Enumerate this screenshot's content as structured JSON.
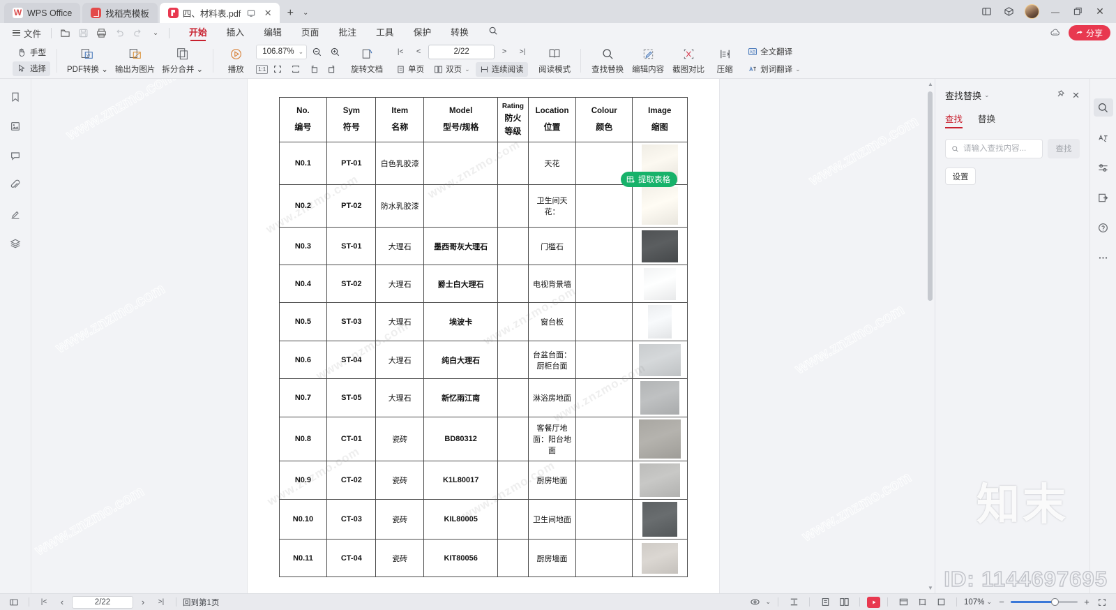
{
  "window": {
    "tabs": [
      {
        "label": "WPS Office",
        "icon": "wps-logo-icon",
        "active": false
      },
      {
        "label": "找稻壳模板",
        "icon": "template-icon",
        "active": false
      },
      {
        "label": "四、材料表.pdf",
        "icon": "pdf-icon",
        "active": true
      }
    ],
    "new_tab": "+",
    "tab_dropdown": "⌄",
    "controls": {
      "split_view": "⊞",
      "cube": "◇",
      "minimize": "—",
      "restore": "❐",
      "close": "✕"
    }
  },
  "menubar": {
    "file": "文件",
    "quick": [
      "new-icon",
      "save-icon",
      "print-icon",
      "undo-icon",
      "redo-icon",
      "customize-icon"
    ],
    "tabs": [
      {
        "label": "开始",
        "active": true
      },
      {
        "label": "插入",
        "active": false
      },
      {
        "label": "编辑",
        "active": false
      },
      {
        "label": "页面",
        "active": false
      },
      {
        "label": "批注",
        "active": false
      },
      {
        "label": "工具",
        "active": false
      },
      {
        "label": "保护",
        "active": false
      },
      {
        "label": "转换",
        "active": false
      }
    ],
    "search_icon": "search-icon",
    "share": "分享"
  },
  "ribbon": {
    "hand": "手型",
    "select": "选择",
    "pdf_convert": "PDF转换",
    "export_image": "输出为图片",
    "split_merge": "拆分合并",
    "play": "播放",
    "zoom_value": "106.87%",
    "zoom_out": "−",
    "zoom_in": "+",
    "fit_actual": "1:1",
    "fit_page": "fit-page-icon",
    "fit_width": "fit-width-icon",
    "rotate_left": "rotate-left-icon",
    "rotate_right": "rotate-right-icon",
    "rotate_doc": "旋转文档",
    "first_page": "|<",
    "prev_page": "<",
    "page_indicator": "2/22",
    "next_page": ">",
    "last_page": ">|",
    "single_page": "单页",
    "double_page": "双页",
    "continuous": "连续阅读",
    "read_mode": "阅读模式",
    "find_replace": "查找替换",
    "edit_content": "编辑内容",
    "screenshot_compare": "截图对比",
    "compress": "压缩",
    "translate_full": "全文翻译",
    "translate_word": "划词翻译"
  },
  "leftrail": {
    "items": [
      {
        "name": "bookmark-icon",
        "label": "书签"
      },
      {
        "name": "thumbnail-icon",
        "label": "缩略图"
      },
      {
        "name": "comment-icon",
        "label": "批注"
      },
      {
        "name": "attachment-icon",
        "label": "附件"
      },
      {
        "name": "signature-icon",
        "label": "签名"
      },
      {
        "name": "layers-icon",
        "label": "图层"
      }
    ]
  },
  "extract_button": {
    "label": "提取表格",
    "color": "#17b26a"
  },
  "find_panel": {
    "title": "查找替换",
    "tabs": [
      {
        "label": "查找",
        "active": true
      },
      {
        "label": "替换",
        "active": false
      }
    ],
    "input_placeholder": "请输入查找内容...",
    "input_value": "",
    "find_button": "查找",
    "settings_button": "设置",
    "pin_icon": "pin-icon",
    "close_icon": "close-icon"
  },
  "rightrail": {
    "items": [
      {
        "name": "search-icon",
        "selected": true
      },
      {
        "name": "translate-icon",
        "selected": false
      },
      {
        "name": "settings-sliders-icon",
        "selected": false
      },
      {
        "name": "export-panel-icon",
        "selected": false
      },
      {
        "name": "help-icon",
        "selected": false
      },
      {
        "name": "more-options-icon",
        "selected": false
      }
    ]
  },
  "statusbar": {
    "sidebar_toggle": "panel-toggle-icon",
    "first": "|<",
    "prev": "‹",
    "page": "2/22",
    "next": "›",
    "last": ">|",
    "back_to_first": "回到第1页",
    "view_icons": [
      "eye-icon",
      "fit-height-icon",
      "single-page-icon",
      "double-page-icon",
      "record-icon",
      "reading-icon",
      "crop-icon",
      "note-icon"
    ],
    "zoom_label": "107%",
    "zoom_minus": "−",
    "zoom_plus": "+",
    "fullscreen": "fullscreen-icon"
  },
  "watermarks": {
    "small": "www.znzmo.com",
    "brand": "知末",
    "id": "ID: 1144697695"
  },
  "document": {
    "table": {
      "headers": [
        {
          "en": "No.",
          "cn": "编号"
        },
        {
          "en": "Sym",
          "cn": "符号"
        },
        {
          "en": "Item",
          "cn": "名称"
        },
        {
          "en": "Model",
          "cn": "型号/规格"
        },
        {
          "en": "Rating",
          "cn": "防火",
          "cn2": "等级"
        },
        {
          "en": "Location",
          "cn": "位置"
        },
        {
          "en": "Colour",
          "cn": "颜色"
        },
        {
          "en": "Image",
          "cn": "缩图"
        }
      ],
      "rows": [
        {
          "no": "N0.1",
          "sym": "PT-01",
          "item": "白色乳胶漆",
          "model": "",
          "rating": "",
          "location": "天花",
          "colour": "",
          "swatch": "#f0ede5",
          "sw": 52,
          "sh": 54
        },
        {
          "no": "N0.2",
          "sym": "PT-02",
          "item": "防水乳胶漆",
          "model": "",
          "rating": "",
          "location": "卫生间天花：",
          "colour": "",
          "swatch": "#f3f0e8",
          "sw": 52,
          "sh": 54
        },
        {
          "no": "N0.3",
          "sym": "ST-01",
          "item": "大理石",
          "model": "墨西哥灰大理石",
          "rating": "",
          "location": "门槛石",
          "colour": "",
          "swatch": "#4f5254",
          "sw": 52,
          "sh": 46
        },
        {
          "no": "N0.4",
          "sym": "ST-02",
          "item": "大理石",
          "model": "爵士白大理石",
          "rating": "",
          "location": "电视背景墙",
          "colour": "",
          "swatch": "#f2f3f4",
          "sw": 46,
          "sh": 46
        },
        {
          "no": "N0.5",
          "sym": "ST-03",
          "item": "大理石",
          "model": "埃波卡",
          "rating": "",
          "location": "窗台板",
          "colour": "",
          "swatch": "#eceef0",
          "sw": 34,
          "sh": 48
        },
        {
          "no": "N0.6",
          "sym": "ST-04",
          "item": "大理石",
          "model": "纯白大理石",
          "rating": "",
          "location": "台盆台面：厨柜台面",
          "colour": "",
          "swatch": "#c9ccce",
          "sw": 60,
          "sh": 46
        },
        {
          "no": "N0.7",
          "sym": "ST-05",
          "item": "大理石",
          "model": "新忆雨江南",
          "rating": "",
          "location": "淋浴房地面",
          "colour": "",
          "swatch": "#b3b5b6",
          "sw": 56,
          "sh": 48
        },
        {
          "no": "N0.8",
          "sym": "CT-01",
          "item": "瓷砖",
          "model": "BD80312",
          "rating": "",
          "location": "客餐厅地面：阳台地面",
          "colour": "",
          "swatch": "#a9a7a2",
          "sw": 60,
          "sh": 56
        },
        {
          "no": "N0.9",
          "sym": "CT-02",
          "item": "瓷砖",
          "model": "K1L80017",
          "rating": "",
          "location": "厨房地面",
          "colour": "",
          "swatch": "#bcbcba",
          "sw": 58,
          "sh": 48
        },
        {
          "no": "N0.10",
          "sym": "CT-03",
          "item": "瓷砖",
          "model": "KIL80005",
          "rating": "",
          "location": "卫生间地面",
          "colour": "",
          "swatch": "#5d6163",
          "sw": 50,
          "sh": 50
        },
        {
          "no": "N0.11",
          "sym": "CT-04",
          "item": "瓷砖",
          "model": "KIT80056",
          "rating": "",
          "location": "厨房墙面",
          "colour": "",
          "swatch": "#cfcbc6",
          "sw": 52,
          "sh": 44
        }
      ]
    }
  }
}
